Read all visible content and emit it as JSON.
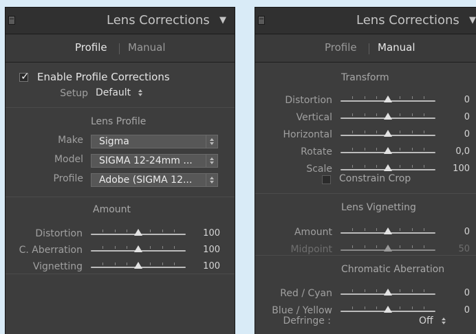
{
  "left_panel": {
    "title": "Lens Corrections",
    "tabs": [
      "Profile",
      "Manual"
    ],
    "enable_label": "Enable Profile Corrections",
    "enable_checked": true,
    "setup": {
      "label": "Setup",
      "value": "Default"
    },
    "lens_profile": {
      "title": "Lens Profile",
      "make": {
        "label": "Make",
        "value": "Sigma"
      },
      "model": {
        "label": "Model",
        "value": "SIGMA 12-24mm ..."
      },
      "profile": {
        "label": "Profile",
        "value": "Adobe (SIGMA 12..."
      }
    },
    "amount": {
      "title": "Amount",
      "sliders": [
        {
          "label": "Distortion",
          "value": "100",
          "level": 0.5
        },
        {
          "label": "C. Aberration",
          "value": "100",
          "level": 0.5
        },
        {
          "label": "Vignetting",
          "value": "100",
          "level": 0.5
        }
      ]
    }
  },
  "right_panel": {
    "title": "Lens Corrections",
    "tabs": [
      "Profile",
      "Manual"
    ],
    "transform": {
      "title": "Transform",
      "sliders": [
        {
          "label": "Distortion",
          "value": "0",
          "level": 0.5
        },
        {
          "label": "Vertical",
          "value": "0",
          "level": 0.5
        },
        {
          "label": "Horizontal",
          "value": "0",
          "level": 0.5
        },
        {
          "label": "Rotate",
          "value": "0,0",
          "level": 0.5
        },
        {
          "label": "Scale",
          "value": "100",
          "level": 0.5
        }
      ],
      "constrain_label": "Constrain Crop",
      "constrain_checked": false
    },
    "vignetting": {
      "title": "Lens Vignetting",
      "sliders": [
        {
          "label": "Amount",
          "value": "0",
          "level": 0.5
        },
        {
          "label": "Midpoint",
          "value": "50",
          "level": 0.5,
          "disabled": true
        }
      ]
    },
    "chromatic": {
      "title": "Chromatic Aberration",
      "sliders": [
        {
          "label": "Red / Cyan",
          "value": "0",
          "level": 0.5
        },
        {
          "label": "Blue / Yellow",
          "value": "0",
          "level": 0.5
        }
      ],
      "defringe": {
        "label": "Defringe :",
        "value": "Off"
      }
    }
  },
  "colors": {
    "background": "#d9ebf7",
    "panel": "#3d3d3d",
    "header": "#303030"
  }
}
